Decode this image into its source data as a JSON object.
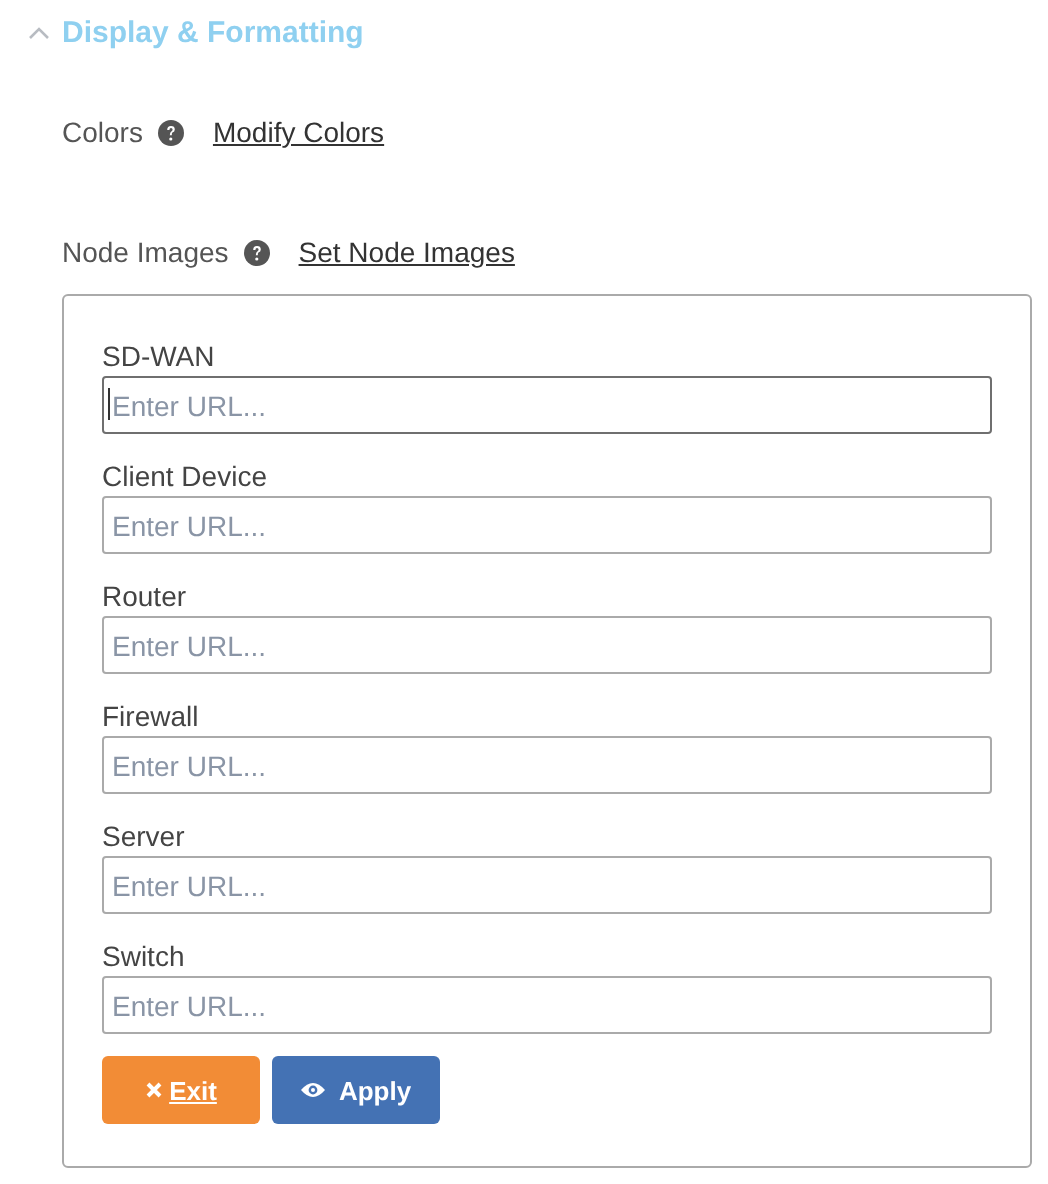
{
  "section": {
    "title": "Display & Formatting",
    "expanded": true
  },
  "settings": [
    {
      "label": "Colors",
      "link": "Modify Colors"
    },
    {
      "label": "Node Images",
      "link": "Set Node Images"
    }
  ],
  "node_images": {
    "fields": [
      {
        "label": "SD-WAN",
        "placeholder": "Enter URL...",
        "focused": true
      },
      {
        "label": "Client Device",
        "placeholder": "Enter URL...",
        "focused": false
      },
      {
        "label": "Router",
        "placeholder": "Enter URL...",
        "focused": false
      },
      {
        "label": "Firewall",
        "placeholder": "Enter URL...",
        "focused": false
      },
      {
        "label": "Server",
        "placeholder": "Enter URL...",
        "focused": false
      },
      {
        "label": "Switch",
        "placeholder": "Enter URL...",
        "focused": false
      }
    ],
    "buttons": [
      {
        "kind": "exit",
        "label": "Exit"
      },
      {
        "kind": "apply",
        "label": "Apply"
      }
    ]
  }
}
